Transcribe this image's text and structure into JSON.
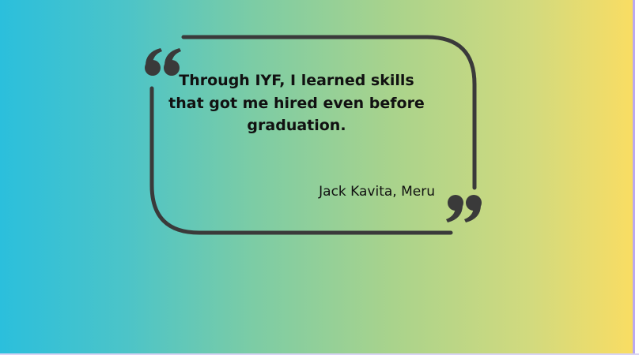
{
  "quote": {
    "text": "Through IYF, I learned skills that got me hired even before graduation.",
    "author": "Jack Kavita, Meru"
  },
  "colors": {
    "gradient_left": "#2bbfdc",
    "gradient_right": "#f9dd63",
    "frame": "#3a3a3a",
    "text": "#111111"
  },
  "icons": {
    "open": "open-quote-icon",
    "close": "close-quote-icon"
  }
}
